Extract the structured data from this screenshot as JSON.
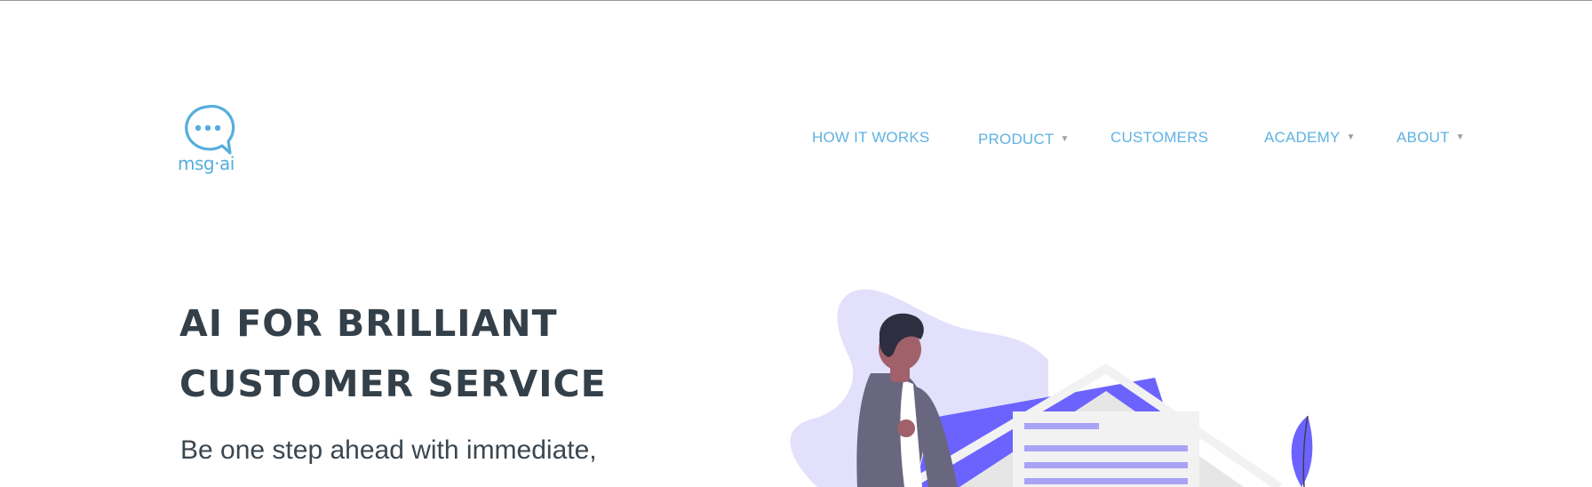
{
  "brand": {
    "name": "msg·ai",
    "color": "#55aedd"
  },
  "nav": {
    "items": [
      {
        "label": "HOW IT WORKS",
        "has_dropdown": false
      },
      {
        "label": "PRODUCT",
        "has_dropdown": true
      },
      {
        "label": "CUSTOMERS",
        "has_dropdown": false
      },
      {
        "label": "ACADEMY",
        "has_dropdown": true
      },
      {
        "label": "ABOUT",
        "has_dropdown": true
      }
    ],
    "color": "#5fb2e2",
    "caret_icon": "caret-down-icon"
  },
  "hero": {
    "headline_line1": "AI FOR BRILLIANT",
    "headline_line2": "CUSTOMER SERVICE",
    "subtext": "Be one step ahead with immediate,",
    "text_color": "#344049",
    "illustration": "person-with-envelope-illustration",
    "accent_color": "#6c63ff",
    "blob_color": "#e2e0fb"
  }
}
